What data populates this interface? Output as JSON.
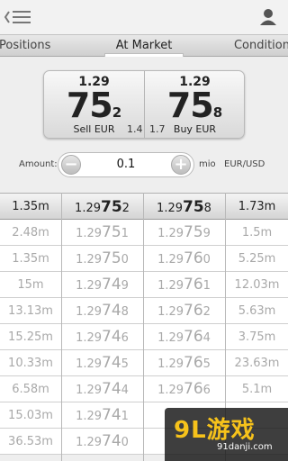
{
  "tabs": [
    {
      "label": "Positions"
    },
    {
      "label": "At Market"
    },
    {
      "label": "Condition"
    }
  ],
  "quote": {
    "sell": {
      "prefix": "1.29",
      "big": "75",
      "small": "2",
      "label": "Sell EUR",
      "spread": "1.4"
    },
    "buy": {
      "prefix": "1.29",
      "big": "75",
      "small": "8",
      "label": "Buy EUR",
      "spread": "1.7"
    }
  },
  "amount": {
    "label": "Amount:",
    "value": "0.1",
    "minus": "−",
    "plus": "+",
    "unit": "mio",
    "pair": "EUR/USD"
  },
  "ladder": {
    "header": {
      "vol_sell": "1.35m",
      "bid_prefix": "1.29",
      "bid_big": "75",
      "bid_small": "2",
      "ask_prefix": "1.29",
      "ask_big": "75",
      "ask_small": "8",
      "vol_buy": "1.73m"
    },
    "rows": [
      {
        "vol_sell": "2.48m",
        "bid_prefix": "1.29",
        "bid_big": "75",
        "bid_small": "1",
        "ask_prefix": "1.29",
        "ask_big": "75",
        "ask_small": "9",
        "vol_buy": "1.5m"
      },
      {
        "vol_sell": "1.35m",
        "bid_prefix": "1.29",
        "bid_big": "75",
        "bid_small": "0",
        "ask_prefix": "1.29",
        "ask_big": "76",
        "ask_small": "0",
        "vol_buy": "5.25m"
      },
      {
        "vol_sell": "15m",
        "bid_prefix": "1.29",
        "bid_big": "74",
        "bid_small": "9",
        "ask_prefix": "1.29",
        "ask_big": "76",
        "ask_small": "1",
        "vol_buy": "12.03m"
      },
      {
        "vol_sell": "13.13m",
        "bid_prefix": "1.29",
        "bid_big": "74",
        "bid_small": "8",
        "ask_prefix": "1.29",
        "ask_big": "76",
        "ask_small": "2",
        "vol_buy": "5.63m"
      },
      {
        "vol_sell": "15.25m",
        "bid_prefix": "1.29",
        "bid_big": "74",
        "bid_small": "6",
        "ask_prefix": "1.29",
        "ask_big": "76",
        "ask_small": "4",
        "vol_buy": "3.75m"
      },
      {
        "vol_sell": "10.33m",
        "bid_prefix": "1.29",
        "bid_big": "74",
        "bid_small": "5",
        "ask_prefix": "1.29",
        "ask_big": "76",
        "ask_small": "5",
        "vol_buy": "23.63m"
      },
      {
        "vol_sell": "6.58m",
        "bid_prefix": "1.29",
        "bid_big": "74",
        "bid_small": "4",
        "ask_prefix": "1.29",
        "ask_big": "76",
        "ask_small": "6",
        "vol_buy": "5.1m"
      },
      {
        "vol_sell": "15.03m",
        "bid_prefix": "1.29",
        "bid_big": "74",
        "bid_small": "1",
        "ask_prefix": "",
        "ask_big": "",
        "ask_small": "",
        "vol_buy": ""
      },
      {
        "vol_sell": "36.53m",
        "bid_prefix": "1.29",
        "bid_big": "74",
        "bid_small": "0",
        "ask_prefix": "",
        "ask_big": "",
        "ask_small": "",
        "vol_buy": ""
      }
    ]
  },
  "watermark": {
    "logo": "9L游戏",
    "sub": "91danji.com"
  },
  "icons": {
    "menu": "menu-back-icon",
    "user": "user-icon"
  },
  "colors": {
    "background": "#eeeeee",
    "muted_text": "#a9a9a9",
    "watermark_accent": "#f6c21b"
  }
}
